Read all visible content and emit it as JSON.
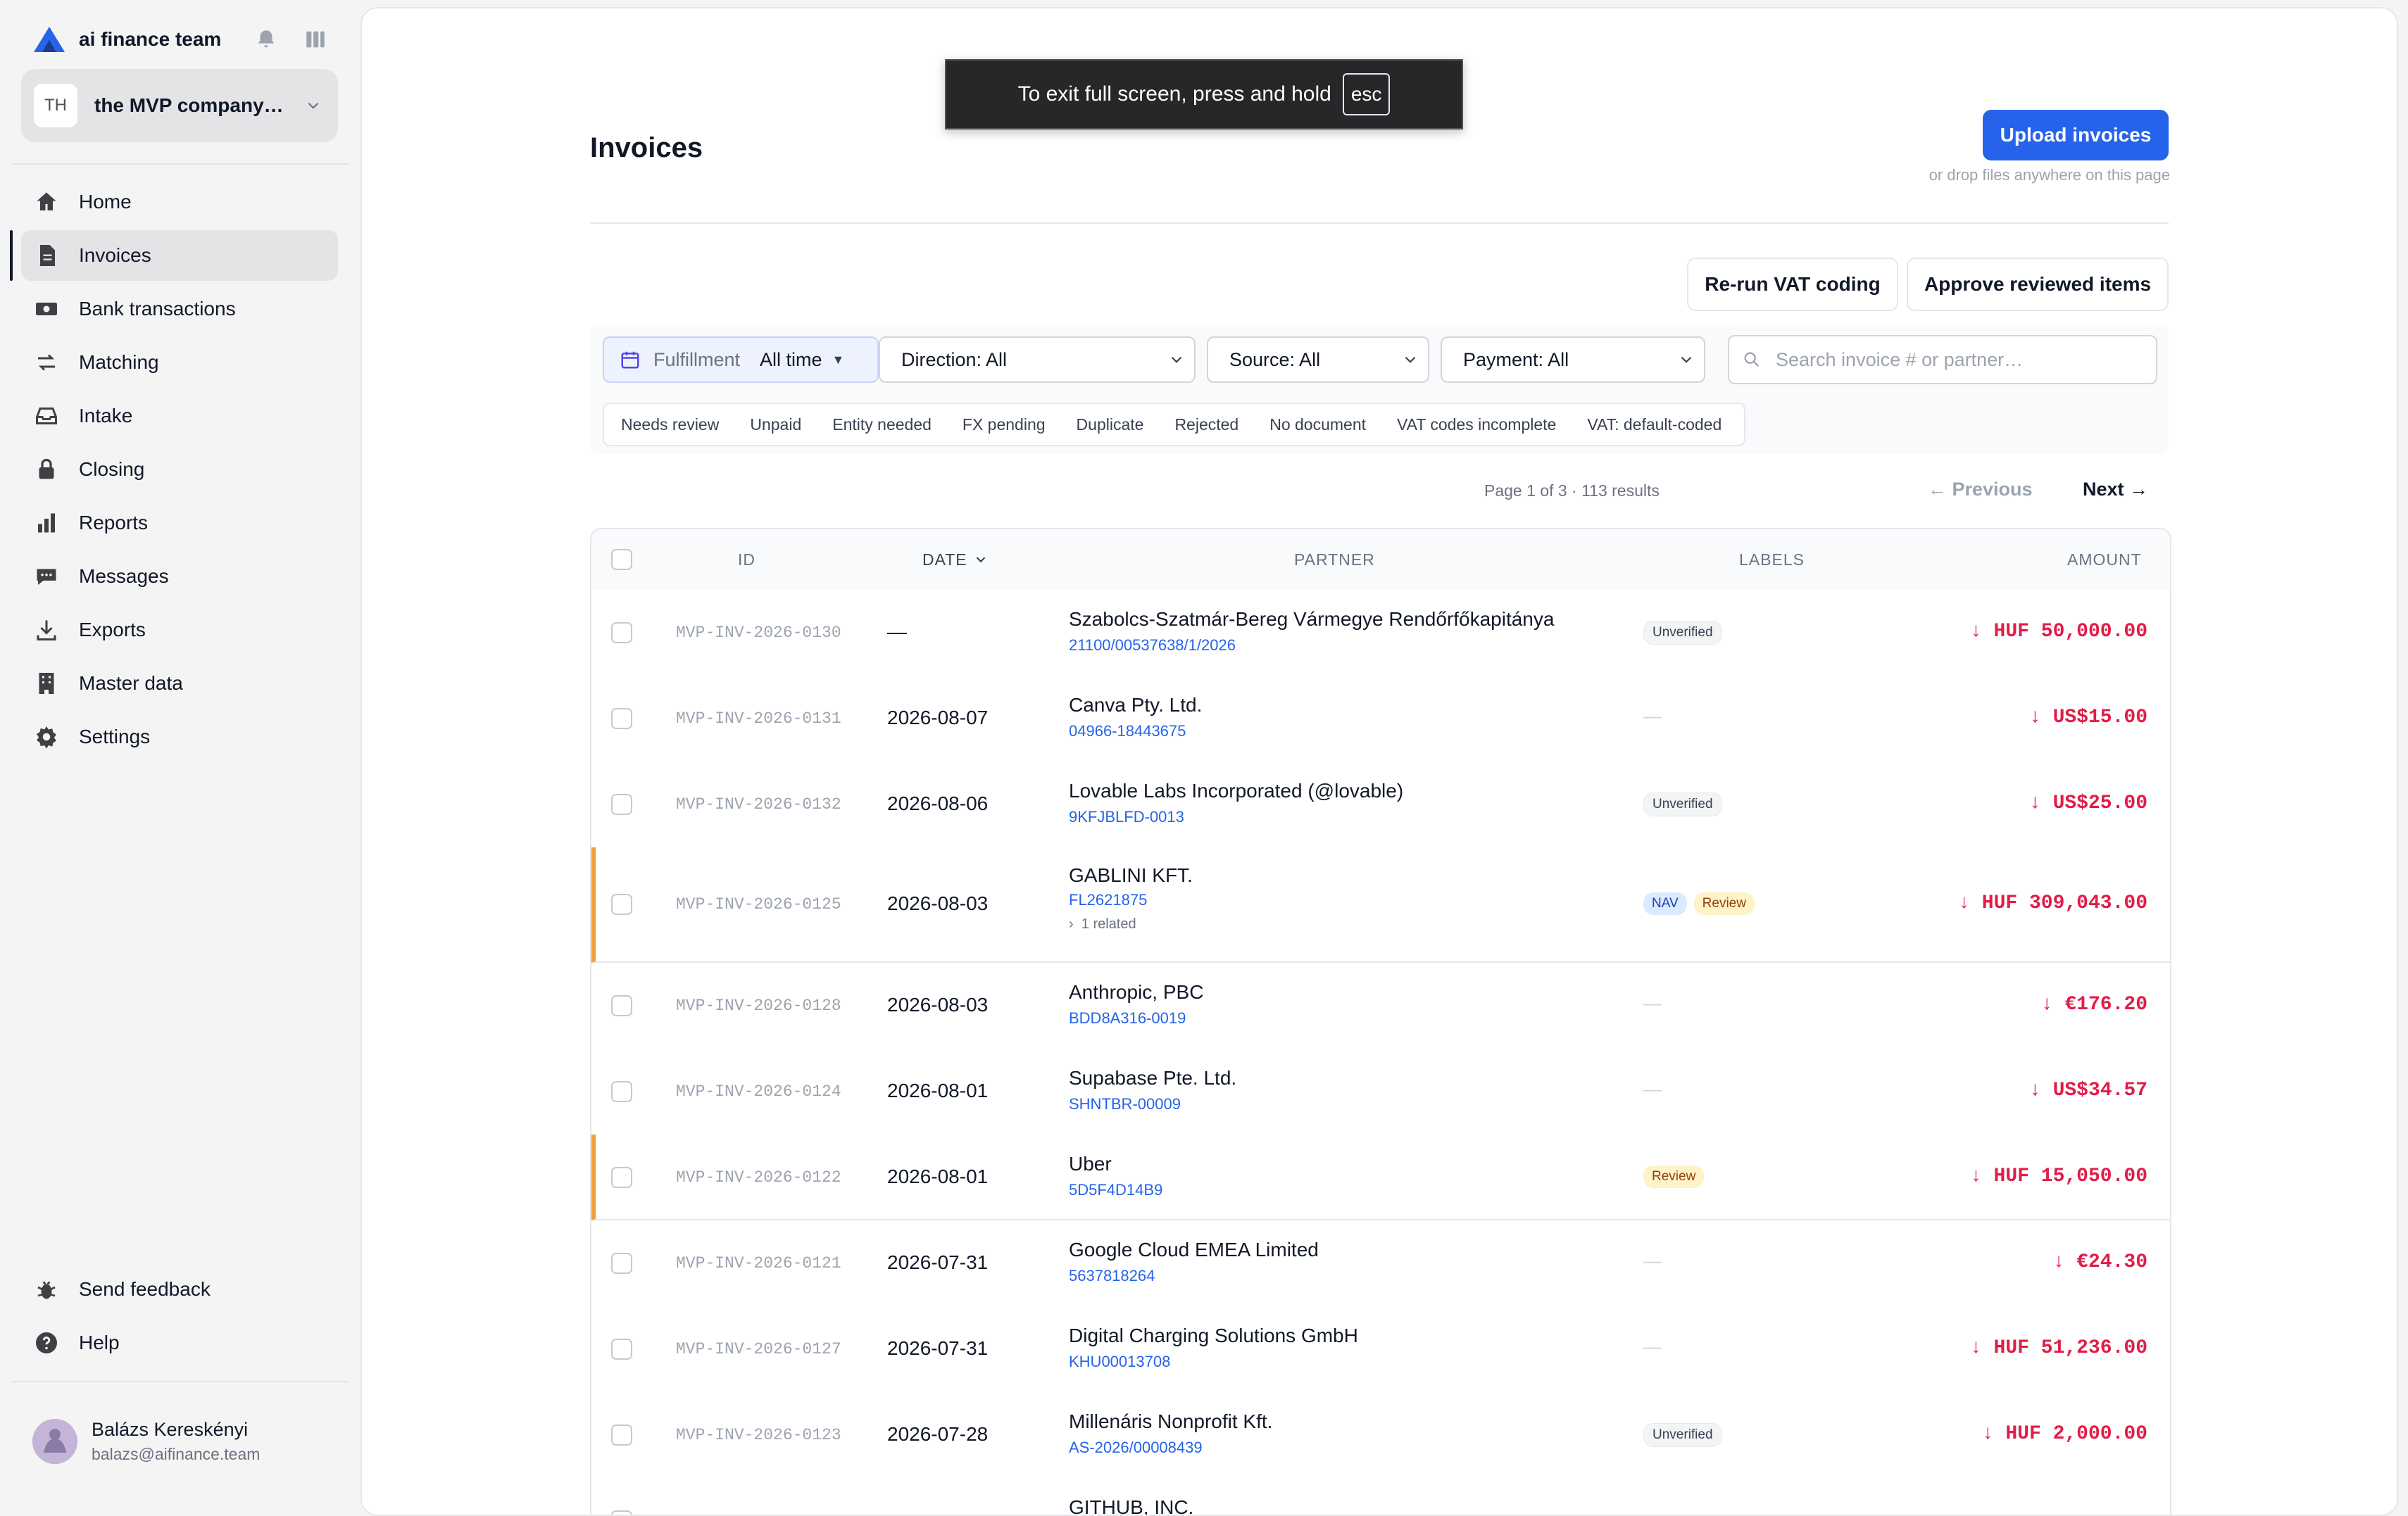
{
  "brand": {
    "name": "ai finance team"
  },
  "company": {
    "initials": "TH",
    "name": "the MVP company…"
  },
  "nav": [
    {
      "label": "Home",
      "icon": "home-icon"
    },
    {
      "label": "Invoices",
      "icon": "invoice-icon"
    },
    {
      "label": "Bank transactions",
      "icon": "bank-icon"
    },
    {
      "label": "Matching",
      "icon": "arrows-swap-icon"
    },
    {
      "label": "Intake",
      "icon": "inbox-icon"
    },
    {
      "label": "Closing",
      "icon": "lock-icon"
    },
    {
      "label": "Reports",
      "icon": "bar-chart-icon"
    },
    {
      "label": "Messages",
      "icon": "chat-icon"
    },
    {
      "label": "Exports",
      "icon": "download-icon"
    },
    {
      "label": "Master data",
      "icon": "building-icon"
    },
    {
      "label": "Settings",
      "icon": "gear-icon"
    }
  ],
  "footer_nav": [
    {
      "label": "Send feedback",
      "icon": "bug-icon"
    },
    {
      "label": "Help",
      "icon": "help-icon"
    }
  ],
  "user": {
    "name": "Balázs Kereskényi",
    "email": "balazs@aifinance.team"
  },
  "toast": {
    "text": "To exit full screen, press and hold",
    "key": "esc"
  },
  "page": {
    "title": "Invoices",
    "upload_label": "Upload invoices",
    "drop_hint": "or drop files anywhere on this page",
    "rerun_label": "Re-run VAT coding",
    "approve_label": "Approve reviewed items"
  },
  "filters": {
    "date_kind": "Fulfillment",
    "date_range": "All time",
    "direction": "Direction: All",
    "source": "Source: All",
    "payment": "Payment: All",
    "search_placeholder": "Search invoice # or partner…",
    "quick": [
      "Needs review",
      "Unpaid",
      "Entity needed",
      "FX pending",
      "Duplicate",
      "Rejected",
      "No document",
      "VAT codes incomplete",
      "VAT: default-coded"
    ]
  },
  "pager": {
    "info": "Page 1 of 3 · 113 results",
    "prev": "← Previous",
    "next": "Next →"
  },
  "table": {
    "headers": {
      "id": "ID",
      "date": "DATE",
      "partner": "PARTNER",
      "labels": "LABELS",
      "amount": "AMOUNT"
    },
    "rows": [
      {
        "id": "MVP-INV-2026-0130",
        "date": "—",
        "partner": "Szabolcs-Szatmár-Bereg Vármegye Rendőrfőkapitánya",
        "ref": "21100/00537638/1/2026",
        "labels": [
          "Unverified"
        ],
        "amount": "↓ HUF 50,000.00"
      },
      {
        "id": "MVP-INV-2026-0131",
        "date": "2026-08-07",
        "partner": "Canva Pty. Ltd.",
        "ref": "04966-18443675",
        "labels": [],
        "amount": "↓ US$15.00"
      },
      {
        "id": "MVP-INV-2026-0132",
        "date": "2026-08-06",
        "partner": "Lovable Labs Incorporated (@lovable)",
        "ref": "9KFJBLFD-0013",
        "labels": [
          "Unverified"
        ],
        "amount": "↓ US$25.00"
      },
      {
        "id": "MVP-INV-2026-0125",
        "date": "2026-08-03",
        "partner": "GABLINI KFT.",
        "ref": "FL2621875",
        "related": "1 related",
        "labels": [
          "NAV",
          "Review"
        ],
        "amount": "↓ HUF 309,043.00"
      },
      {
        "id": "MVP-INV-2026-0128",
        "date": "2026-08-03",
        "partner": "Anthropic, PBC",
        "ref": "BDD8A316-0019",
        "labels": [],
        "amount": "↓ €176.20"
      },
      {
        "id": "MVP-INV-2026-0124",
        "date": "2026-08-01",
        "partner": "Supabase Pte. Ltd.",
        "ref": "SHNTBR-00009",
        "labels": [],
        "amount": "↓ US$34.57"
      },
      {
        "id": "MVP-INV-2026-0122",
        "date": "2026-08-01",
        "partner": "Uber",
        "ref": "5D5F4D14B9",
        "labels": [
          "Review"
        ],
        "amount": "↓ HUF 15,050.00"
      },
      {
        "id": "MVP-INV-2026-0121",
        "date": "2026-07-31",
        "partner": "Google Cloud EMEA Limited",
        "ref": "5637818264",
        "labels": [],
        "amount": "↓ €24.30"
      },
      {
        "id": "MVP-INV-2026-0127",
        "date": "2026-07-31",
        "partner": "Digital Charging Solutions GmbH",
        "ref": "KHU00013708",
        "labels": [],
        "amount": "↓ HUF 51,236.00"
      },
      {
        "id": "MVP-INV-2026-0123",
        "date": "2026-07-28",
        "partner": "Millenáris Nonprofit Kft.",
        "ref": "AS-2026/00008439",
        "labels": [
          "Unverified"
        ],
        "amount": "↓ HUF 2,000.00"
      },
      {
        "partner": "GITHUB, INC."
      }
    ]
  }
}
